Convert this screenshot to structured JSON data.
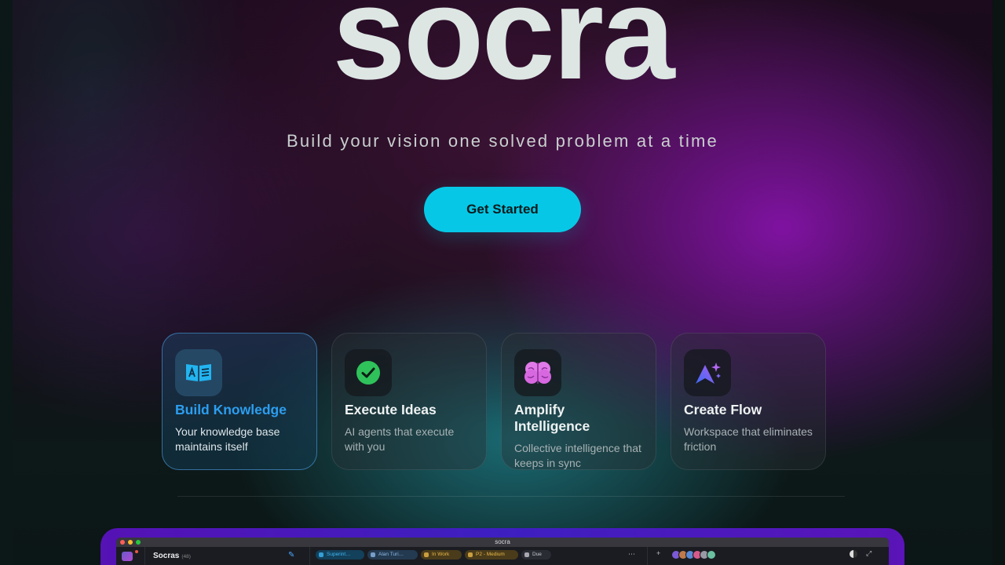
{
  "hero": {
    "logo": "socra",
    "tagline": "Build your vision one solved problem at a time",
    "cta_label": "Get Started"
  },
  "features": [
    {
      "title": "Build Knowledge",
      "desc": "Your knowledge base maintains itself",
      "icon": "book-icon",
      "active": true,
      "accent": "#2c9ef0"
    },
    {
      "title": "Execute Ideas",
      "desc": "AI agents that execute with you",
      "icon": "check-circle-icon",
      "active": false
    },
    {
      "title": "Amplify Intelligence",
      "desc": "Collective intelligence that keeps in sync",
      "icon": "brain-icon",
      "active": false
    },
    {
      "title": "Create Flow",
      "desc": "Workspace that eliminates friction",
      "icon": "sparkle-arrow-icon",
      "active": false
    }
  ],
  "colors": {
    "cta": "#06c8e6",
    "active_card_title": "#2c9ef0",
    "mockup_frame": "#5512b4"
  },
  "app_preview": {
    "window_title": "socra",
    "workspace_name": "Socras",
    "workspace_count": "(48)",
    "chips": [
      {
        "label": "Superint…",
        "icon": "folder-icon"
      },
      {
        "label": "Alan Turi…",
        "icon": "user-icon"
      },
      {
        "label": "In Work",
        "icon": "status-icon"
      },
      {
        "label": "P2 - Medium",
        "icon": "priority-icon"
      },
      {
        "label": "Due",
        "icon": "clock-icon"
      }
    ]
  }
}
